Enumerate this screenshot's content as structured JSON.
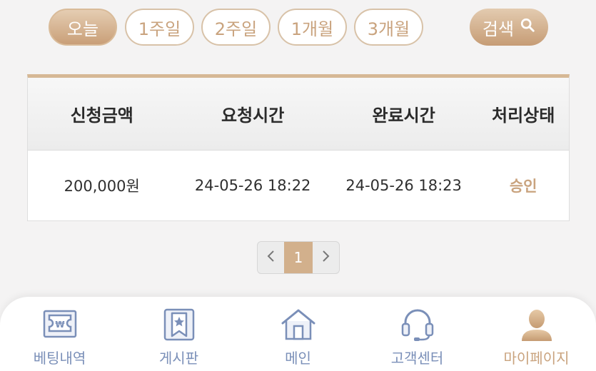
{
  "filters": {
    "today": "오늘",
    "week1": "1주일",
    "week2": "2주일",
    "month1": "1개월",
    "month3": "3개월",
    "search_label": "검색"
  },
  "table": {
    "headers": [
      "신청금액",
      "요청시간",
      "완료시간",
      "처리상태"
    ],
    "rows": [
      {
        "amount": "200,000원",
        "requested": "24-05-26 18:22",
        "completed": "24-05-26 18:23",
        "status": "승인"
      }
    ]
  },
  "pagination": {
    "prev": "‹",
    "current": "1",
    "next": "›"
  },
  "bottom_nav": {
    "items": [
      {
        "label": "베팅내역",
        "icon": "betting-ticket-icon"
      },
      {
        "label": "게시판",
        "icon": "bookmark-star-icon"
      },
      {
        "label": "메인",
        "icon": "home-icon"
      },
      {
        "label": "고객센터",
        "icon": "headset-icon"
      },
      {
        "label": "마이페이지",
        "icon": "user-icon"
      }
    ],
    "active": "마이페이지"
  },
  "colors": {
    "accent_gold": "#c9a37e",
    "nav_blue": "#7a8fb8",
    "background": "#f4f3f3"
  }
}
